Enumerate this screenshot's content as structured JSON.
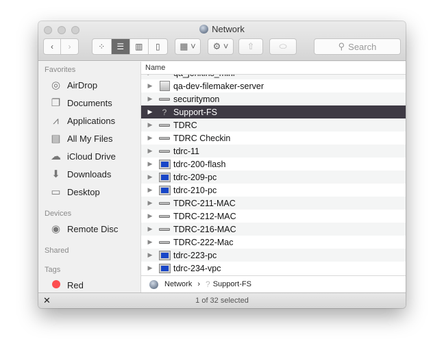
{
  "window": {
    "title": "Network"
  },
  "toolbar": {
    "search_placeholder": "Search"
  },
  "sidebar": {
    "favorites_label": "Favorites",
    "favorites": [
      {
        "label": "AirDrop",
        "icon": "airdrop-icon"
      },
      {
        "label": "Documents",
        "icon": "documents-icon"
      },
      {
        "label": "Applications",
        "icon": "applications-icon"
      },
      {
        "label": "All My Files",
        "icon": "all-files-icon"
      },
      {
        "label": "iCloud Drive",
        "icon": "cloud-icon"
      },
      {
        "label": "Downloads",
        "icon": "downloads-icon"
      },
      {
        "label": "Desktop",
        "icon": "desktop-icon"
      }
    ],
    "devices_label": "Devices",
    "devices": [
      {
        "label": "Remote Disc",
        "icon": "disc-icon"
      }
    ],
    "shared_label": "Shared",
    "tags_label": "Tags",
    "tags": [
      {
        "label": "Red",
        "color": "#fc4d4f"
      }
    ]
  },
  "list": {
    "column_name": "Name",
    "items": [
      {
        "name": "qa_jenkins_mini",
        "icon": "server"
      },
      {
        "name": "qa-dev-filemaker-server",
        "icon": "mac"
      },
      {
        "name": "securitymon",
        "icon": "server"
      },
      {
        "name": "Support-FS",
        "icon": "question",
        "selected": true
      },
      {
        "name": "TDRC",
        "icon": "server"
      },
      {
        "name": "TDRC Checkin",
        "icon": "server"
      },
      {
        "name": "tdrc-11",
        "icon": "server"
      },
      {
        "name": "tdrc-200-flash",
        "icon": "pc"
      },
      {
        "name": "tdrc-209-pc",
        "icon": "pc"
      },
      {
        "name": "tdrc-210-pc",
        "icon": "pc"
      },
      {
        "name": "TDRC-211-MAC",
        "icon": "server"
      },
      {
        "name": "TDRC-212-MAC",
        "icon": "server"
      },
      {
        "name": "TDRC-216-MAC",
        "icon": "server"
      },
      {
        "name": "TDRC-222-Mac",
        "icon": "server"
      },
      {
        "name": "tdrc-223-pc",
        "icon": "pc"
      },
      {
        "name": "tdrc-234-vpc",
        "icon": "pc"
      }
    ]
  },
  "pathbar": {
    "items": [
      "Network",
      "Support-FS"
    ],
    "separator": "›"
  },
  "status": {
    "text": "1 of 32 selected"
  }
}
